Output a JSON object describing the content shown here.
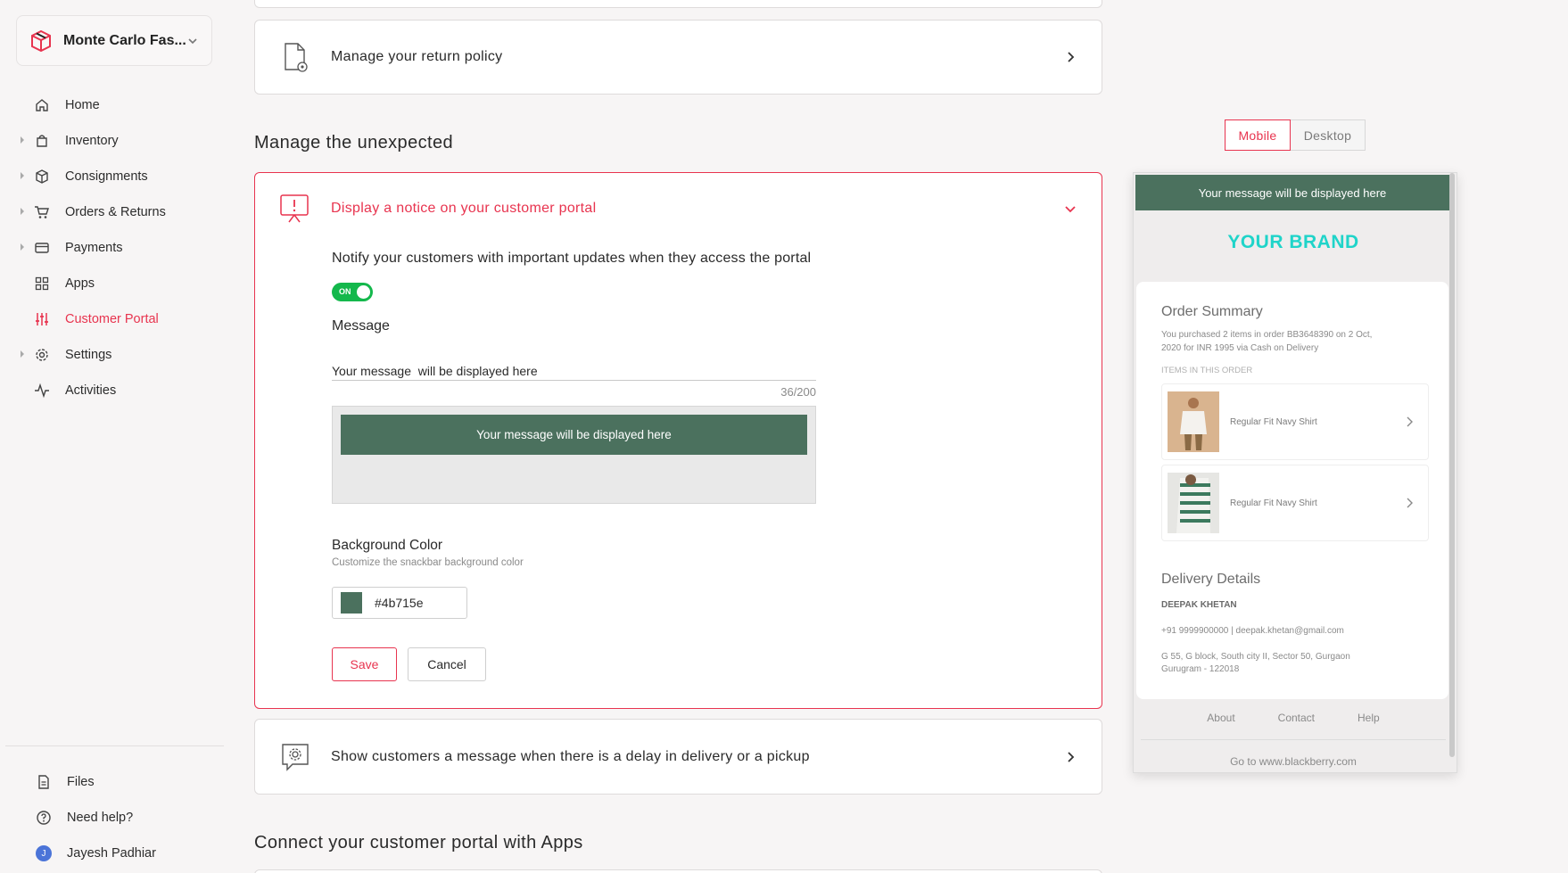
{
  "colors": {
    "accent": "#e8344f",
    "toggle_on": "#14b84c",
    "snackbar": "#4b715e",
    "brand_text": "#1fd4c9",
    "avatar": "#4b74d8"
  },
  "sidebar": {
    "store_name": "Monte Carlo Fas...",
    "items": [
      {
        "label": "Home",
        "icon": "home-icon",
        "expandable": false
      },
      {
        "label": "Inventory",
        "icon": "bag-icon",
        "expandable": true
      },
      {
        "label": "Consignments",
        "icon": "box-icon",
        "expandable": true
      },
      {
        "label": "Orders & Returns",
        "icon": "cart-icon",
        "expandable": true
      },
      {
        "label": "Payments",
        "icon": "card-icon",
        "expandable": true
      },
      {
        "label": "Apps",
        "icon": "grid-icon",
        "expandable": false
      },
      {
        "label": "Customer Portal",
        "icon": "sliders-icon",
        "expandable": false,
        "active": true
      },
      {
        "label": "Settings",
        "icon": "gear-icon",
        "expandable": true
      },
      {
        "label": "Activities",
        "icon": "activity-icon",
        "expandable": false
      }
    ],
    "bottom": [
      {
        "label": "Files",
        "icon": "file-icon"
      },
      {
        "label": "Need help?",
        "icon": "help-icon"
      },
      {
        "label": "Jayesh Padhiar",
        "icon": "avatar",
        "initial": "J"
      }
    ]
  },
  "main": {
    "return_policy_label": "Manage your return policy",
    "unexpected_title": "Manage the unexpected",
    "notice": {
      "title": "Display a notice on your customer portal",
      "description": "Notify your customers with important updates when they access the portal",
      "toggle_label": "ON",
      "toggle_on": true,
      "message_label": "Message",
      "message_value": "Your message  will be displayed here",
      "counter": "36/200",
      "preview_text": "Your message will be displayed here",
      "bg_label": "Background Color",
      "bg_sub": "Customize the snackbar background color",
      "bg_value": "#4b715e",
      "save_label": "Save",
      "cancel_label": "Cancel"
    },
    "delay_label": "Show customers a message when there is a delay in delivery or a pickup",
    "connect_title": "Connect your customer portal with Apps"
  },
  "preview": {
    "tabs": [
      "Mobile",
      "Desktop"
    ],
    "selected_tab": "Mobile",
    "banner": "Your message will be displayed here",
    "brand": "YOUR BRAND",
    "order_summary_title": "Order Summary",
    "order_summary_text_1": "You purchased 2 items in order BB3648390 on 2 Oct,",
    "order_summary_text_2": "2020 for INR 1995 via Cash on Delivery",
    "items_caption": "ITEMS IN THIS ORDER",
    "items": [
      {
        "name": "Regular Fit Navy Shirt"
      },
      {
        "name": "Regular Fit Navy Shirt"
      }
    ],
    "delivery_title": "Delivery Details",
    "customer_name": "DEEPAK KHETAN",
    "contact": "+91 9999900000 | deepak.khetan@gmail.com",
    "address_1": "G 55, G block, South city II, Sector 50, Gurgaon",
    "address_2": "Gurugram - 122018",
    "footer_links": [
      "About",
      "Contact",
      "Help"
    ],
    "footer_url": "Go to www.blackberry.com"
  }
}
